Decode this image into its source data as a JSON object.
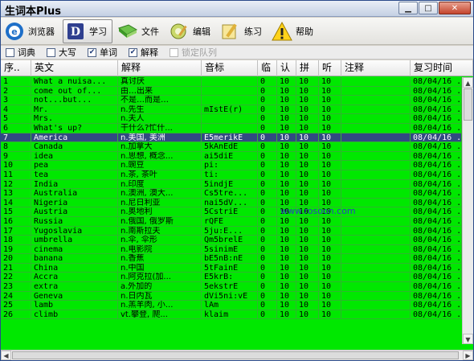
{
  "window": {
    "title": "生词本Plus"
  },
  "toolbar": {
    "buttons": [
      {
        "label": "浏览器",
        "icon": "browser-icon"
      },
      {
        "label": "学习",
        "icon": "study-icon",
        "active": true
      },
      {
        "label": "文件",
        "icon": "file-icon"
      },
      {
        "label": "编辑",
        "icon": "edit-icon"
      },
      {
        "label": "练习",
        "icon": "practice-icon"
      },
      {
        "label": "帮助",
        "icon": "help-icon"
      }
    ]
  },
  "checkbar": {
    "items": [
      {
        "label": "词典",
        "checked": false
      },
      {
        "label": "大写",
        "checked": false
      },
      {
        "label": "单词",
        "checked": true
      },
      {
        "label": "解释",
        "checked": true
      },
      {
        "label": "锁定队列",
        "checked": false,
        "disabled": true
      }
    ]
  },
  "table": {
    "headers": [
      "序..",
      "英文",
      "解释",
      "音标",
      "临",
      "认",
      "拼",
      "听",
      "注释",
      "复习时间"
    ],
    "rows": [
      [
        "1",
        "What a nuisa...",
        "真讨厌",
        "",
        "0",
        "10",
        "10",
        "10",
        "",
        "08/04/16 ."
      ],
      [
        "2",
        "come out of...",
        "由…出来",
        "",
        "0",
        "10",
        "10",
        "10",
        "",
        "08/04/16 ."
      ],
      [
        "3",
        "not...but...",
        "不是…而是…",
        "",
        "0",
        "10",
        "10",
        "10",
        "",
        "08/04/16 ."
      ],
      [
        "4",
        "Mr.",
        "n.先生",
        "mIstE(r)",
        "0",
        "10",
        "10",
        "10",
        "",
        "08/04/16 ."
      ],
      [
        "5",
        "Mrs.",
        "n.夫人",
        "",
        "0",
        "10",
        "10",
        "10",
        "",
        "08/04/16 ."
      ],
      [
        "6",
        "What's up?",
        "干什么?忙什...",
        "",
        "0",
        "10",
        "10",
        "10",
        "",
        "08/04/16 ."
      ],
      [
        "7",
        "America",
        "n.美国, 美洲",
        "E5merikE",
        "0",
        "10",
        "10",
        "10",
        "",
        "08/04/16 ."
      ],
      [
        "8",
        "Canada",
        "n.加拿大",
        "5kAnEdE",
        "0",
        "10",
        "10",
        "10",
        "",
        "08/04/16 ."
      ],
      [
        "9",
        "idea",
        "n.思想, 概念...",
        "ai5diE",
        "0",
        "10",
        "10",
        "10",
        "",
        "08/04/16 ."
      ],
      [
        "10",
        "pea",
        "n.豌豆",
        "pi:",
        "0",
        "10",
        "10",
        "10",
        "",
        "08/04/16 ."
      ],
      [
        "11",
        "tea",
        "n.茶, 茶叶",
        "ti:",
        "0",
        "10",
        "10",
        "10",
        "",
        "08/04/16 ."
      ],
      [
        "12",
        "India",
        "n.印度",
        "5indjE",
        "0",
        "10",
        "10",
        "10",
        "",
        "08/04/16 ."
      ],
      [
        "13",
        "Australia",
        "n.澳洲, 澳大...",
        "Cs5tre...",
        "0",
        "10",
        "10",
        "10",
        "",
        "08/04/16 ."
      ],
      [
        "14",
        "Nigeria",
        "n.尼日利亚",
        "nai5dV...",
        "0",
        "10",
        "10",
        "10",
        "",
        "08/04/16 ."
      ],
      [
        "15",
        "Austria",
        "n.奥地利",
        "5CstriE",
        "0",
        "10",
        "10",
        "10",
        "",
        "08/04/16 ."
      ],
      [
        "16",
        "Russia",
        "n.俄国, 俄罗斯",
        "rQFE",
        "0",
        "10",
        "10",
        "10",
        "",
        "08/04/16 ."
      ],
      [
        "17",
        "Yugoslavia",
        "n.南斯拉夫",
        "5ju:E...",
        "0",
        "10",
        "10",
        "10",
        "",
        "08/04/16 ."
      ],
      [
        "18",
        "umbrella",
        "n.伞, 伞形",
        "Qm5brelE",
        "0",
        "10",
        "10",
        "10",
        "",
        "08/04/16 ."
      ],
      [
        "19",
        "cinema",
        "n.电影院",
        "5sinimE",
        "0",
        "10",
        "10",
        "10",
        "",
        "08/04/16 ."
      ],
      [
        "20",
        "banana",
        "n.香蕉",
        "bE5nB:nE",
        "0",
        "10",
        "10",
        "10",
        "",
        "08/04/16 ."
      ],
      [
        "21",
        "China",
        "n.中国",
        "5tFainE",
        "0",
        "10",
        "10",
        "10",
        "",
        "08/04/16 ."
      ],
      [
        "22",
        "Accra",
        "n.阿克拉(加...",
        "E5krB:",
        "0",
        "10",
        "10",
        "10",
        "",
        "08/04/16 ."
      ],
      [
        "23",
        "extra",
        "a.外加的",
        "5ekstrE",
        "0",
        "10",
        "10",
        "10",
        "",
        "08/04/16 ."
      ],
      [
        "24",
        "Geneva",
        "n.日内瓦",
        "dVi5ni:vE",
        "0",
        "10",
        "10",
        "10",
        "",
        "08/04/16 ."
      ],
      [
        "25",
        "lamb",
        "n.羔羊肉, 小...",
        "lAm",
        "0",
        "10",
        "10",
        "10",
        "",
        "08/04/16 ."
      ],
      [
        "26",
        "climb",
        "vt.攀登, 爬...",
        "klaim",
        "0",
        "10",
        "10",
        "10",
        "",
        "08/04/16 ."
      ]
    ],
    "selected_row": 6
  },
  "watermark": "www.rosoon.com",
  "colors": {
    "grid_bg": "#00e800",
    "selected_bg": "#314a82"
  }
}
